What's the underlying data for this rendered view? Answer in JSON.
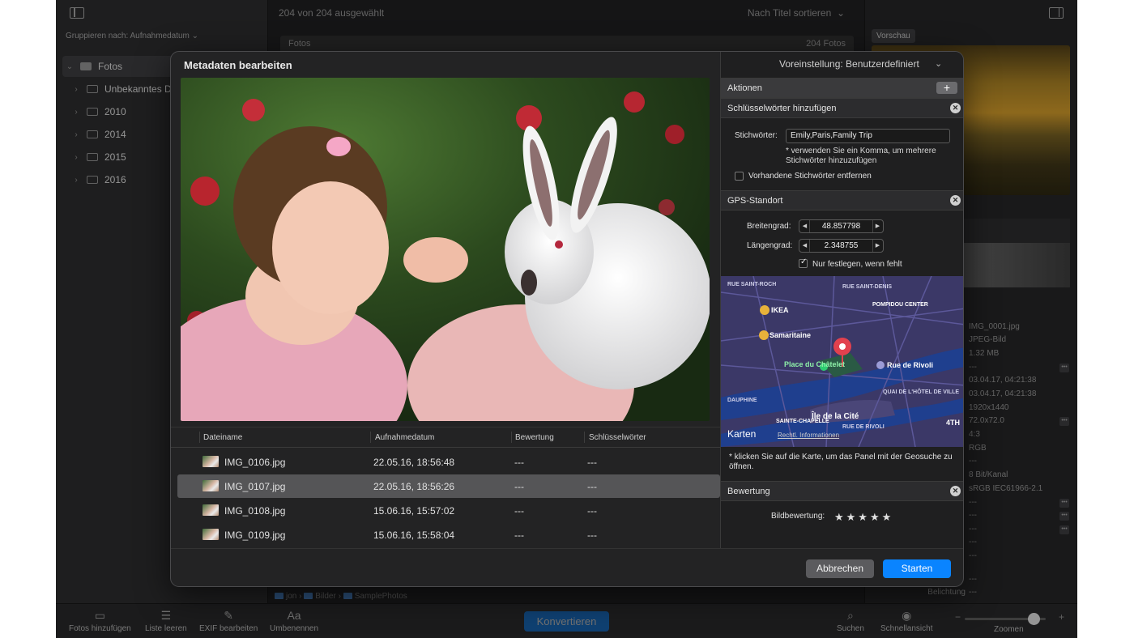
{
  "left": {
    "group_label": "Gruppieren nach: Aufnahmedatum",
    "tree": [
      {
        "label": "Fotos"
      },
      {
        "label": "Unbekanntes Datum"
      },
      {
        "label": "2010"
      },
      {
        "label": "2014"
      },
      {
        "label": "2015"
      },
      {
        "label": "2016"
      }
    ]
  },
  "center": {
    "selection_status": "204 von 204 ausgewählt",
    "sort_label": "Nach Titel sortieren",
    "fotos_label": "Fotos",
    "fotos_count": "204 Fotos",
    "breadcrumb": [
      "jon",
      "Bilder",
      "SamplePhotos"
    ]
  },
  "right": {
    "preview_tag": "Vorschau",
    "info_values": [
      "IMG_0001.jpg",
      "JPEG-Bild",
      "1.32 MB",
      "---",
      "03.04.17, 04:21:38",
      "03.04.17, 04:21:38",
      "1920x1440",
      "72.0x72.0",
      "4:3",
      "RGB",
      "---",
      "8 Bit/Kanal",
      "sRGB IEC61966-2.1",
      "---",
      "---",
      "---",
      "---",
      "---",
      "---",
      "---"
    ],
    "label_belichtung": "Belichtung"
  },
  "toolbar": {
    "add_photos": "Fotos hinzufügen",
    "clear_list": "Liste leeren",
    "edit_exif": "EXIF bearbeiten",
    "rename": "Umbenennen",
    "rename_icon_text": "Aa",
    "convert": "Konvertieren",
    "search": "Suchen",
    "quicklook": "Schnellansicht",
    "zoom": "Zoomen",
    "zoom_minus": "−",
    "zoom_plus": "+"
  },
  "dialog": {
    "title": "Metadaten bearbeiten",
    "preset": "Voreinstellung: Benutzerdefiniert",
    "columns": [
      "Dateiname",
      "Aufnahmedatum",
      "Bewertung",
      "Schlüsselwörter"
    ],
    "rows": [
      {
        "name": "IMG_0106.jpg",
        "date": "22.05.16, 18:56:48",
        "rating": "---",
        "keywords": "---"
      },
      {
        "name": "IMG_0107.jpg",
        "date": "22.05.16, 18:56:26",
        "rating": "---",
        "keywords": "---"
      },
      {
        "name": "IMG_0108.jpg",
        "date": "15.06.16, 15:57:02",
        "rating": "---",
        "keywords": "---"
      },
      {
        "name": "IMG_0109.jpg",
        "date": "15.06.16, 15:58:04",
        "rating": "---",
        "keywords": "---"
      }
    ],
    "selected_row": 1,
    "cancel": "Abbrechen",
    "start": "Starten",
    "actions": {
      "title": "Aktionen",
      "keywords_section": "Schlüsselwörter hinzufügen",
      "keywords_label": "Stichwörter:",
      "keywords_value": "Emily,Paris,Family Trip",
      "keywords_hint": "* verwenden Sie ein Komma, um mehrere Stichwörter hinzuzufügen",
      "remove_existing": "Vorhandene Stichwörter entfernen",
      "remove_existing_checked": false,
      "gps_section": "GPS-Standort",
      "lat_label": "Breitengrad:",
      "lat_value": "48.857798",
      "lon_label": "Längengrad:",
      "lon_value": "2.348755",
      "only_if_missing": "Nur festlegen, wenn fehlt",
      "only_if_missing_checked": true,
      "map_note": "* klicken Sie auf die Karte, um das Panel mit der Geosuche zu öffnen.",
      "rating_section": "Bewertung",
      "rating_label": "Bildbewertung:",
      "rating_stars": "★★★★★"
    },
    "map": {
      "labels": [
        "RUE SAINT-ROCH",
        "RUE SAINT-DENIS",
        "IKEA",
        "POMPIDOU CENTER",
        "Samaritaine",
        "Place du Châtelet",
        "Rue de Rivoli",
        "Île de la Cité",
        "SAINTE-CHAPELLE",
        "4TH",
        "RUE DE RIVOLI",
        "QUAI DE L'HÔTEL DE VILLE",
        "DAUPHINE"
      ],
      "brand": "Karten",
      "legal": "Rechtl. Informationen"
    }
  }
}
